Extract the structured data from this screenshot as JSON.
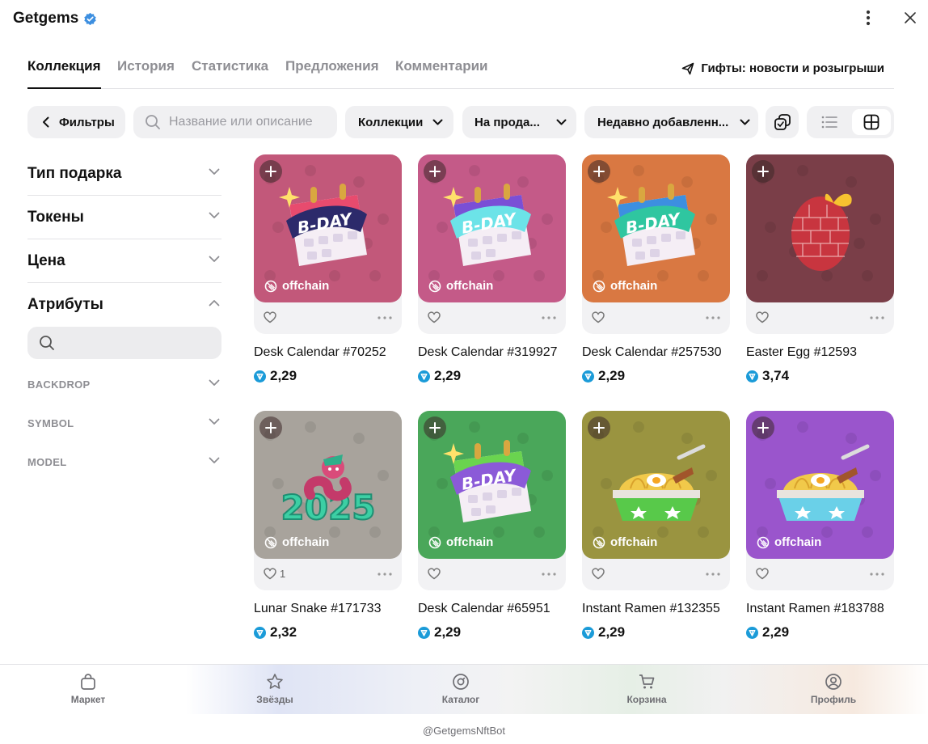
{
  "app": {
    "title": "Getgems"
  },
  "tabs": [
    {
      "label": "Коллекция",
      "active": true
    },
    {
      "label": "История",
      "active": false
    },
    {
      "label": "Статистика",
      "active": false
    },
    {
      "label": "Предложения",
      "active": false
    },
    {
      "label": "Комментарии",
      "active": false
    }
  ],
  "news_link": {
    "label": "Гифты: новости и розыгрыши",
    "icon": "paper-plane-icon"
  },
  "toolbar": {
    "filters_label": "Фильтры",
    "search_placeholder": "Название или описание",
    "collections_label": "Коллекции",
    "sale_label": "На прода...",
    "sort_label": "Недавно добавленн...",
    "view_mode": "grid"
  },
  "sidebar": {
    "filters": [
      {
        "label": "Тип подарка",
        "open": false
      },
      {
        "label": "Токены",
        "open": false
      },
      {
        "label": "Цена",
        "open": false
      },
      {
        "label": "Атрибуты",
        "open": true
      }
    ],
    "attributes": [
      "BACKDROP",
      "SYMBOL",
      "MODEL"
    ]
  },
  "items": [
    {
      "name": "Desk Calendar #70252",
      "price": "2,29",
      "badge": "offchain",
      "likes": "",
      "bg": "#c2587a",
      "art": "calendar",
      "cal": "#e84b6e",
      "bday": "#2c2a6b"
    },
    {
      "name": "Desk Calendar #319927",
      "price": "2,29",
      "badge": "offchain",
      "likes": "",
      "bg": "#c45a88",
      "art": "calendar",
      "cal": "#7a4fd6",
      "bday": "#6ce3e8"
    },
    {
      "name": "Desk Calendar #257530",
      "price": "2,29",
      "badge": "offchain",
      "likes": "",
      "bg": "#d97842",
      "art": "calendar",
      "cal": "#3d8fe0",
      "bday": "#2fc6a0"
    },
    {
      "name": "Easter Egg #12593",
      "price": "3,74",
      "badge": "",
      "likes": "",
      "bg": "#7a3e48",
      "art": "egg"
    },
    {
      "name": "Lunar Snake #171733",
      "price": "2,32",
      "badge": "offchain",
      "likes": "1",
      "bg": "#a8a39c",
      "art": "snake"
    },
    {
      "name": "Desk Calendar #65951",
      "price": "2,29",
      "badge": "offchain",
      "likes": "",
      "bg": "#4aa75a",
      "art": "calendar",
      "cal": "#6ad44f",
      "bday": "#8b5ad8"
    },
    {
      "name": "Instant Ramen #132355",
      "price": "2,29",
      "badge": "offchain",
      "likes": "",
      "bg": "#9a9440",
      "art": "ramen",
      "bowl": "#58c94a"
    },
    {
      "name": "Instant Ramen #183788",
      "price": "2,29",
      "badge": "offchain",
      "likes": "",
      "bg": "#9a55cc",
      "art": "ramen",
      "bowl": "#6ad0e8"
    }
  ],
  "bottom_nav": [
    {
      "label": "Маркет",
      "icon": "bag-icon"
    },
    {
      "label": "Звёзды",
      "icon": "star-icon"
    },
    {
      "label": "Каталог",
      "icon": "compass-icon"
    },
    {
      "label": "Корзина",
      "icon": "cart-icon"
    },
    {
      "label": "Профиль",
      "icon": "profile-icon"
    }
  ],
  "footer": {
    "handle": "@GetgemsNftBot"
  },
  "colors": {
    "ton": "#1b9bd8",
    "text": "#111111",
    "muted": "#8e8e93",
    "pill": "#f0f0f2"
  }
}
